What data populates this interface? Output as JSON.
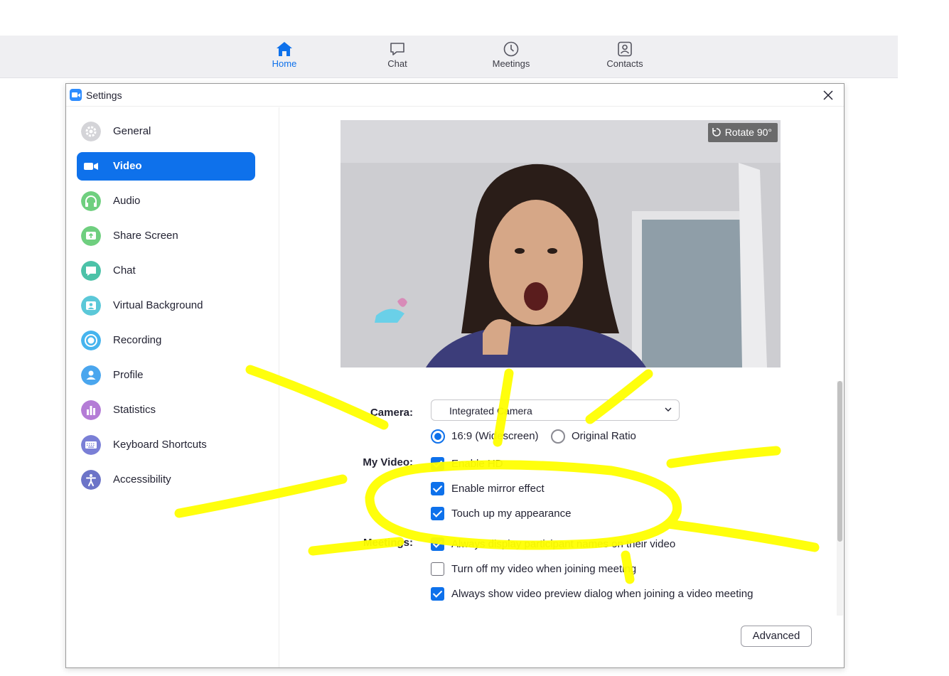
{
  "topnav": {
    "items": [
      {
        "label": "Home",
        "icon": "home-icon",
        "active": true
      },
      {
        "label": "Chat",
        "icon": "chat-bubble-icon",
        "active": false
      },
      {
        "label": "Meetings",
        "icon": "clock-icon",
        "active": false
      },
      {
        "label": "Contacts",
        "icon": "contacts-icon",
        "active": false
      }
    ]
  },
  "window": {
    "title": "Settings",
    "close_icon": "close-icon"
  },
  "sidebar": {
    "items": [
      {
        "label": "General",
        "icon": "gear-icon",
        "color": "#d4d4d8"
      },
      {
        "label": "Video",
        "icon": "video-camera-icon",
        "color": "#0e71eb",
        "active": true
      },
      {
        "label": "Audio",
        "icon": "headphones-icon",
        "color": "#6fcf7f"
      },
      {
        "label": "Share Screen",
        "icon": "share-screen-icon",
        "color": "#6fcf7f"
      },
      {
        "label": "Chat",
        "icon": "chat-bubble-icon",
        "color": "#4cc2a8"
      },
      {
        "label": "Virtual Background",
        "icon": "virtual-background-icon",
        "color": "#5bc8d8"
      },
      {
        "label": "Recording",
        "icon": "record-icon",
        "color": "#46b4ee"
      },
      {
        "label": "Profile",
        "icon": "profile-icon",
        "color": "#4aa6ee"
      },
      {
        "label": "Statistics",
        "icon": "bar-chart-icon",
        "color": "#b47cd6"
      },
      {
        "label": "Keyboard Shortcuts",
        "icon": "keyboard-icon",
        "color": "#7a7fd6"
      },
      {
        "label": "Accessibility",
        "icon": "accessibility-icon",
        "color": "#6c74c8"
      }
    ]
  },
  "video": {
    "rotate_label": "Rotate 90°",
    "camera_label": "Camera:",
    "camera_value": "Integrated Camera",
    "ratio_options": [
      {
        "label": "16:9 (Widescreen)",
        "selected": true
      },
      {
        "label": "Original Ratio",
        "selected": false
      }
    ],
    "my_video_label": "My Video:",
    "my_video_options": [
      {
        "label": "Enable HD",
        "checked": true
      },
      {
        "label": "Enable mirror effect",
        "checked": true
      },
      {
        "label": "Touch up my appearance",
        "checked": true
      }
    ],
    "meetings_label": "Meetings:",
    "meetings_options": [
      {
        "label": "Always display participant names on their video",
        "checked": true
      },
      {
        "label": "Turn off my video when joining meeting",
        "checked": false
      },
      {
        "label": "Always show video preview dialog when joining a video meeting",
        "checked": true
      }
    ],
    "advanced_label": "Advanced"
  },
  "annotation": {
    "color": "#ffff00"
  }
}
